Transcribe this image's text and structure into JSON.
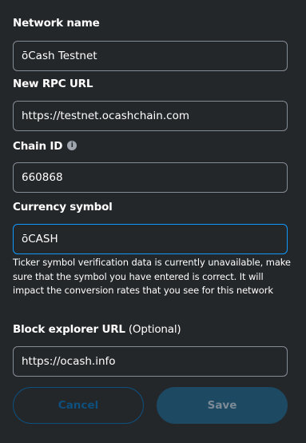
{
  "network_name": {
    "label": "Network name",
    "value": "ōCash Testnet"
  },
  "rpc_url": {
    "label": "New RPC URL",
    "value": "https://testnet.ocashchain.com"
  },
  "chain_id": {
    "label": "Chain ID",
    "info_icon": "i",
    "value": "660868"
  },
  "currency_symbol": {
    "label": "Currency symbol",
    "value": "ōCASH",
    "warning": "Ticker symbol verification data is currently unavailable, make sure that the symbol you have entered is correct. It will impact the conversion rates that you see for this network"
  },
  "block_explorer": {
    "label": "Block explorer URL",
    "optional_label": "(Optional)",
    "value": "https://ocash.info"
  },
  "buttons": {
    "cancel_label": "Cancel",
    "save_label": "Save"
  },
  "colors": {
    "background": "#24272a",
    "focus_border": "#1098fc",
    "cancel": "#0d4f7d",
    "save_bg": "#1d4963"
  }
}
